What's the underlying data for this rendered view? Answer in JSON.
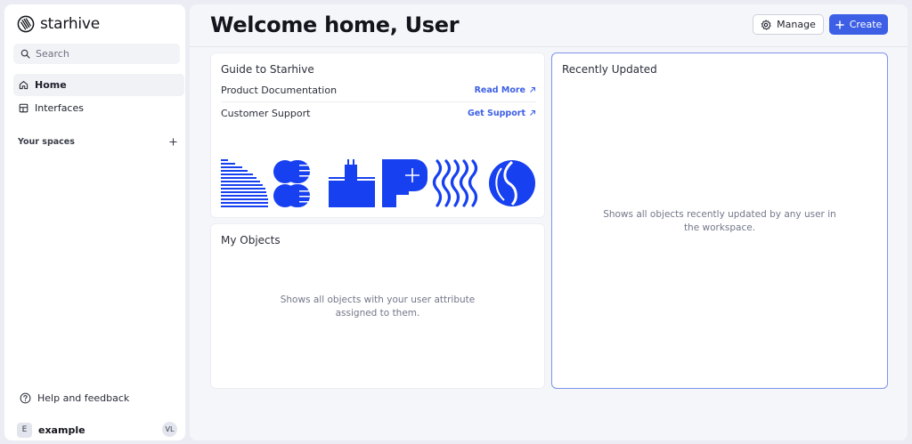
{
  "brand": {
    "name": "starhive"
  },
  "sidebar": {
    "search_placeholder": "Search",
    "nav": [
      {
        "label": "Home",
        "icon": "home-icon",
        "active": true
      },
      {
        "label": "Interfaces",
        "icon": "interfaces-icon",
        "active": false
      }
    ],
    "spaces_label": "Your spaces",
    "help_label": "Help and feedback",
    "workspace": {
      "badge": "E",
      "name": "example",
      "avatar": "VL"
    }
  },
  "header": {
    "title": "Welcome home, User",
    "manage_label": "Manage",
    "create_label": "Create"
  },
  "guide": {
    "title": "Guide to Starhive",
    "rows": [
      {
        "label": "Product Documentation",
        "link": "Read More"
      },
      {
        "label": "Customer Support",
        "link": "Get Support"
      }
    ]
  },
  "my_objects": {
    "title": "My Objects",
    "empty_line1": "Shows all objects with your user attribute",
    "empty_line2": "assigned to them."
  },
  "recent": {
    "title": "Recently Updated",
    "empty_line1": "Shows all objects recently updated by any user in",
    "empty_line2": "the workspace."
  },
  "colors": {
    "accent": "#3d5fe6",
    "illustration": "#1740f0",
    "app_background": "#ecedf4",
    "card_background": "#ffffff",
    "selected_card_border": "#7b93ee"
  }
}
